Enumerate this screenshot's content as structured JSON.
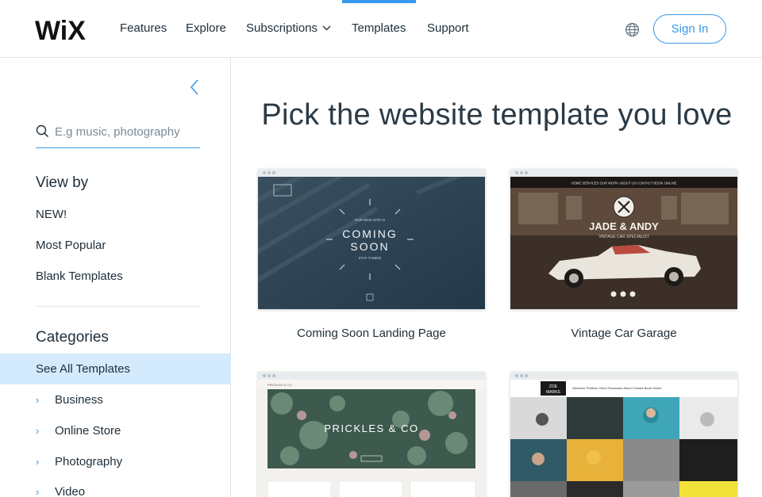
{
  "header": {
    "logo_text": "WiX",
    "nav": {
      "features": "Features",
      "explore": "Explore",
      "subscriptions": "Subscriptions",
      "templates": "Templates",
      "support": "Support"
    },
    "active_tab": "Templates",
    "signin_label": "Sign In",
    "accent_color": "#3899ec"
  },
  "sidebar": {
    "search_placeholder": "E.g music, photography",
    "view_by": {
      "title": "View by",
      "items": [
        "NEW!",
        "Most Popular",
        "Blank Templates"
      ]
    },
    "categories": {
      "title": "Categories",
      "selected": "See All Templates",
      "items": [
        "Business",
        "Online Store",
        "Photography",
        "Video"
      ]
    }
  },
  "main": {
    "title": "Pick the website template you love",
    "templates": [
      {
        "label": "Coming Soon Landing Page",
        "thumb": {
          "line1": "COMING",
          "line2": "SOON",
          "tag": "OUR NEW SITE IS",
          "sub": "STAY TUNED!"
        }
      },
      {
        "label": "Vintage Car Garage",
        "thumb": {
          "title": "JADE & ANDY",
          "sub": "VINTAGE CAR SPECIALIST",
          "menu": "HOME   SERVICES   OUR WORK   ABOUT US   CONTACT   BOOK ONLINE"
        }
      },
      {
        "label": "",
        "thumb": {
          "title": "PRICKLES & CO",
          "brand": "PRICKLES & CO"
        }
      },
      {
        "label": "",
        "thumb": {
          "brand_line1": "ZOE",
          "brand_line2": "MARKS",
          "menu": "Welcome   Portfolio   Client Showcase   About   Contact   Book Online"
        }
      }
    ]
  }
}
